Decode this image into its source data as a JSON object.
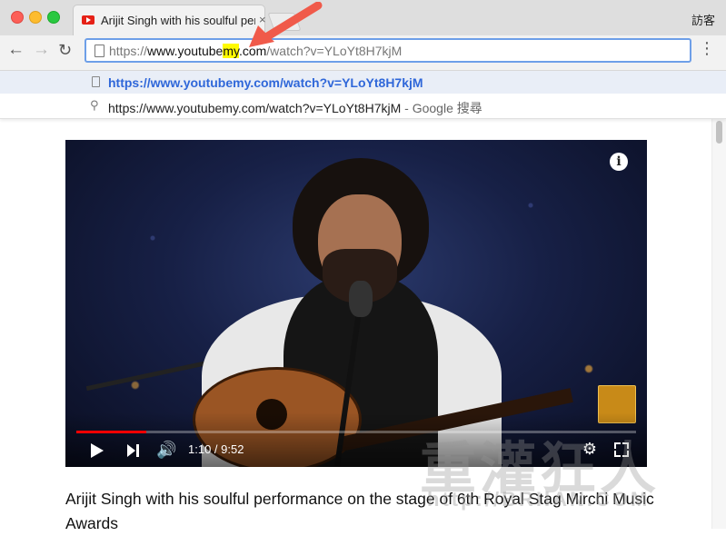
{
  "window": {
    "tab_title": "Arijit Singh with his soulful per",
    "tab_close": "×",
    "guest_label": "訪客"
  },
  "toolbar": {
    "back_icon": "←",
    "forward_icon": "→",
    "reload_icon": "↻",
    "menu_icon": "⋮",
    "url_prefix": "https://",
    "url_domain_start": "www.youtube",
    "url_domain_highlight": "my",
    "url_domain_end": ".com",
    "url_path": "/watch?v=YLoYt8H7kjM"
  },
  "suggestions": [
    {
      "icon": "page-icon",
      "text": "https://www.youtubemy.com/watch?v=YLoYt8H7kjM",
      "suffix": ""
    },
    {
      "icon": "search-icon",
      "text": "https://www.youtubemy.com/watch?v=YLoYt8H7kjM",
      "suffix": " - Google 搜尋"
    }
  ],
  "video": {
    "info_icon": "i",
    "progress": 0.125,
    "time": "1:10 / 9:52",
    "volume_icon": "🔊",
    "settings_icon": "⚙"
  },
  "page": {
    "title": "Arijit Singh with his soulful performance on the stage of 6th Royal Stag Mirchi Music Awards"
  },
  "watermark": {
    "text": "重灌狂人",
    "url": "http://BRIIAN.COM"
  },
  "colors": {
    "accent": "#6e9fe8",
    "highlight": "#fffa00",
    "progress": "#ff0000",
    "arrow": "#f05a4a"
  }
}
